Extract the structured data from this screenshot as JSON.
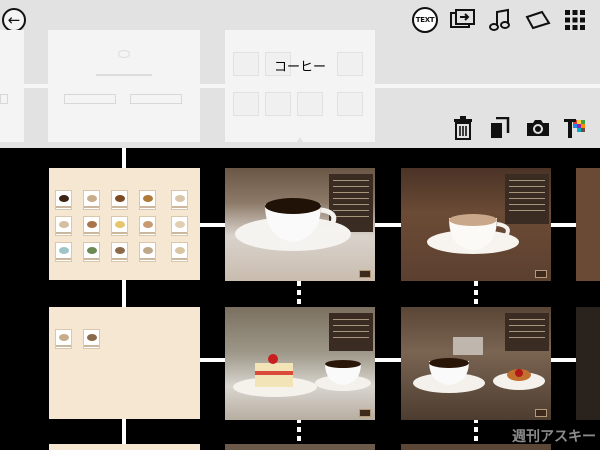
{
  "header": {
    "back_icon": "circled-left-arrow-icon",
    "text_toggle_label": "TEXT",
    "section_label": "コーヒー"
  },
  "toolbar": {
    "top_icons": [
      "text-toggle-icon",
      "slideshow-icon",
      "music-note-icon",
      "tag-icon",
      "grid-view-icon"
    ],
    "edit_icons": [
      "trash-icon",
      "copy-page-icon",
      "camera-icon",
      "text-color-icon"
    ]
  },
  "watermark": "週刊アスキー"
}
